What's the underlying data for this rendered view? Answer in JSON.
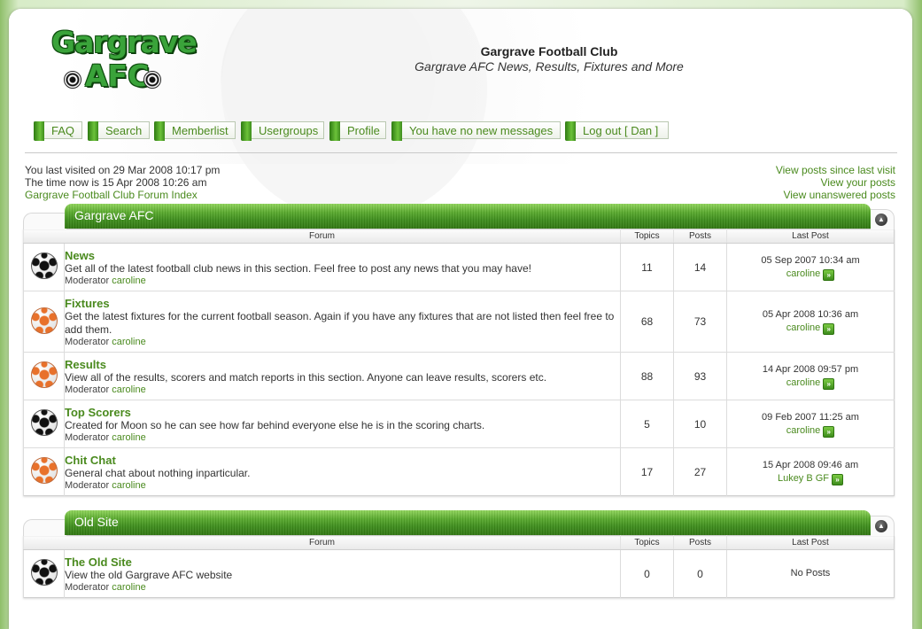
{
  "site": {
    "logo_line1": "Gargrave",
    "logo_line2": "AFC",
    "title": "Gargrave Football Club",
    "description": "Gargrave AFC News, Results, Fixtures and More"
  },
  "nav": [
    {
      "label": "FAQ"
    },
    {
      "label": "Search"
    },
    {
      "label": "Memberlist"
    },
    {
      "label": "Usergroups"
    },
    {
      "label": "Profile"
    },
    {
      "label": "You have no new messages"
    },
    {
      "label": "Log out [ Dan ]"
    }
  ],
  "info": {
    "last_visit": "You last visited on 29 Mar 2008 10:17 pm",
    "time_now": "The time now is 15 Apr 2008 10:26 am",
    "index_link": "Gargrave Football Club Forum Index",
    "links": [
      "View posts since last visit",
      "View your posts",
      "View unanswered posts"
    ]
  },
  "columns": {
    "forum": "Forum",
    "topics": "Topics",
    "posts": "Posts",
    "last_post": "Last Post"
  },
  "moderator_label": "Moderator",
  "categories": [
    {
      "title": "Gargrave AFC",
      "forums": [
        {
          "name": "News",
          "desc": "Get all of the latest football club news in this section. Feel free to post any news that you may have!",
          "moderator": "caroline",
          "topics": "11",
          "posts": "14",
          "last_date": "05 Sep 2007 10:34 am",
          "last_user": "caroline",
          "icon": "black"
        },
        {
          "name": "Fixtures",
          "desc": "Get the latest fixtures for the current football season. Again if you have any fixtures that are not listed then feel free to add them.",
          "moderator": "caroline",
          "topics": "68",
          "posts": "73",
          "last_date": "05 Apr 2008 10:36 am",
          "last_user": "caroline",
          "icon": "orange"
        },
        {
          "name": "Results",
          "desc": "View all of the results, scorers and match reports in this section. Anyone can leave results, scorers etc.",
          "moderator": "caroline",
          "topics": "88",
          "posts": "93",
          "last_date": "14 Apr 2008 09:57 pm",
          "last_user": "caroline",
          "icon": "orange"
        },
        {
          "name": "Top Scorers",
          "desc": "Created for Moon so he can see how far behind everyone else he is in the scoring charts.",
          "moderator": "caroline",
          "topics": "5",
          "posts": "10",
          "last_date": "09 Feb 2007 11:25 am",
          "last_user": "caroline",
          "icon": "black"
        },
        {
          "name": "Chit Chat",
          "desc": "General chat about nothing inparticular.",
          "moderator": "caroline",
          "topics": "17",
          "posts": "27",
          "last_date": "15 Apr 2008 09:46 am",
          "last_user": "Lukey B GF",
          "icon": "orange"
        }
      ]
    },
    {
      "title": "Old Site",
      "forums": [
        {
          "name": "The Old Site",
          "desc": "View the old Gargrave AFC website",
          "moderator": "caroline",
          "topics": "0",
          "posts": "0",
          "last_date": "No Posts",
          "last_user": "",
          "icon": "black"
        }
      ]
    }
  ],
  "colors": {
    "accent": "#4a8a1e",
    "bar_top": "#8fd45a",
    "bar_bottom": "#2f7510"
  }
}
